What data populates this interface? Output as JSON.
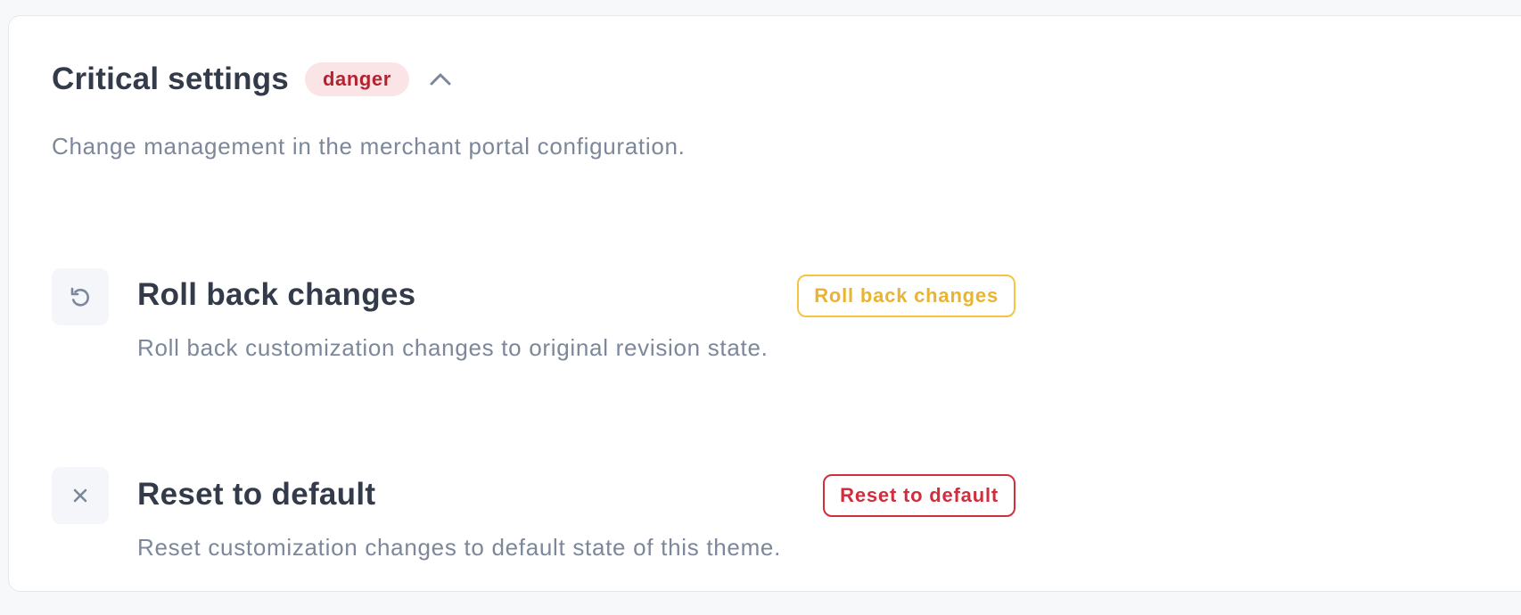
{
  "section": {
    "title": "Critical settings",
    "badge": "danger",
    "toggle_icon": "chevron-up-icon",
    "description": "Change management in the merchant portal configuration."
  },
  "actions": [
    {
      "icon": "undo-icon",
      "title": "Roll back changes",
      "description": "Roll back customization changes to original revision state.",
      "button_label": "Roll back changes",
      "button_variant": "warning"
    },
    {
      "icon": "close-icon",
      "title": "Reset to default",
      "description": "Reset customization changes to default state of this theme.",
      "button_label": "Reset to default",
      "button_variant": "danger"
    }
  ],
  "colors": {
    "badge_bg": "#fbe4e6",
    "badge_text": "#b4232f",
    "warning": "#f5c443",
    "danger": "#cf2f3d",
    "title": "#333b4a",
    "muted": "#7c879a"
  }
}
